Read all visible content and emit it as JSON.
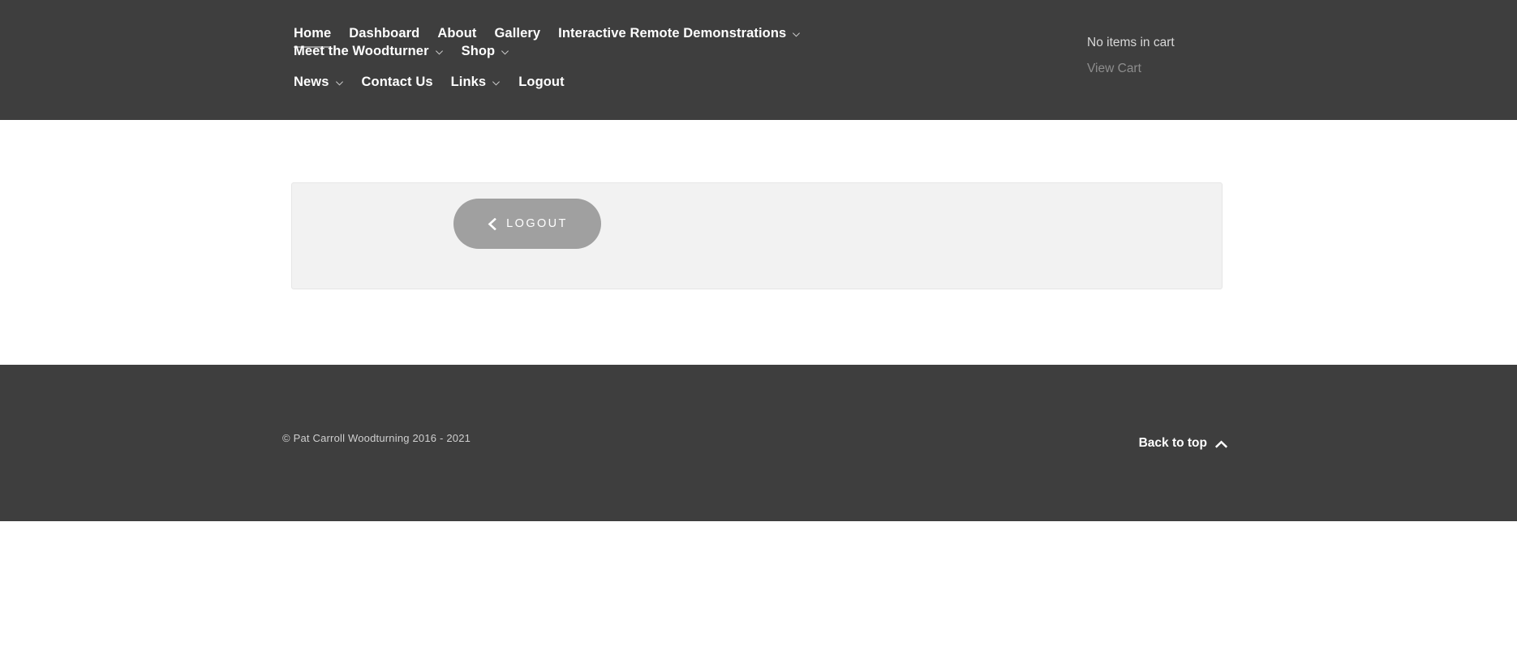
{
  "header": {
    "background_color": "#3e3e3e",
    "nav_rows": [
      [
        {
          "label": "Home",
          "has_dropdown": false,
          "active": true
        },
        {
          "label": "Dashboard",
          "has_dropdown": false,
          "active": false
        },
        {
          "label": "About",
          "has_dropdown": false,
          "active": false
        },
        {
          "label": "Gallery",
          "has_dropdown": false,
          "active": false
        },
        {
          "label": "Interactive Remote Demonstrations",
          "has_dropdown": true,
          "active": false
        },
        {
          "label": "Meet the Woodturner",
          "has_dropdown": true,
          "active": false
        },
        {
          "label": "Shop",
          "has_dropdown": true,
          "active": false
        }
      ],
      [
        {
          "label": "News",
          "has_dropdown": true,
          "active": false
        },
        {
          "label": "Contact Us",
          "has_dropdown": false,
          "active": false
        },
        {
          "label": "Links",
          "has_dropdown": true,
          "active": false
        },
        {
          "label": "Logout",
          "has_dropdown": false,
          "active": false
        }
      ]
    ],
    "cart": {
      "status": "No items in cart",
      "view_cart_label": "View Cart"
    }
  },
  "main": {
    "panel": {
      "background_color": "#f2f2f2",
      "border_color": "#e6e6e6"
    },
    "logout_button": {
      "label": "Logout",
      "icon": "chevron-left-icon",
      "background_color": "#a0a0a0",
      "text_color": "#ffffff"
    }
  },
  "footer": {
    "background_color": "#3e3e3e",
    "copyright": "© Pat Carroll Woodturning 2016 - 2021",
    "back_to_top": {
      "label": "Back to top",
      "icon": "chevron-up-icon"
    }
  }
}
